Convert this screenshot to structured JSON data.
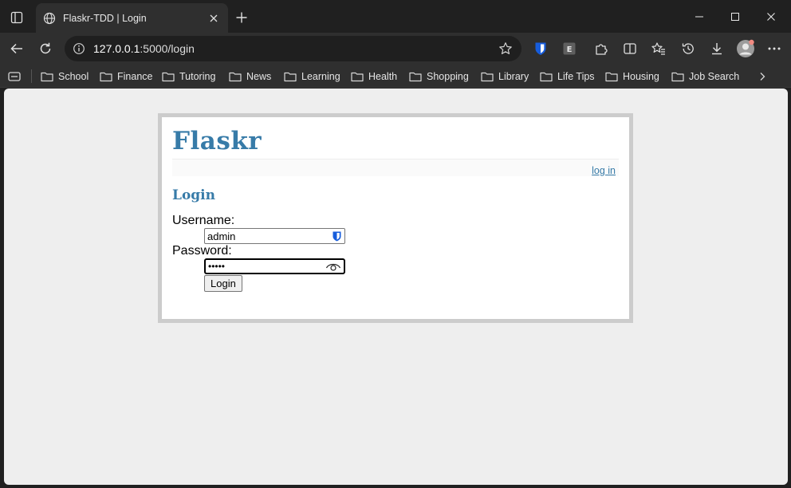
{
  "browser": {
    "tab": {
      "title": "Flaskr-TDD | Login"
    },
    "address": {
      "host": "127.0.0.1",
      "rest": ":5000/login"
    },
    "bookmarks": [
      "School",
      "Finance",
      "Tutoring",
      "News",
      "Learning",
      "Health",
      "Shopping",
      "Library",
      "Life Tips",
      "Housing",
      "Job Search"
    ],
    "icons": {
      "tab_favicon": "globe-icon",
      "extensions": [
        "bitwarden-icon",
        "e-extension-icon",
        "puzzle-icon",
        "split-screen-icon",
        "favorites-icon",
        "history-icon",
        "download-icon",
        "profile-avatar",
        "more-icon"
      ]
    },
    "colors": {
      "chrome_bg": "#202020",
      "toolbar_bg": "#2f2f2f",
      "bitwarden_blue": "#175ddc"
    }
  },
  "page": {
    "site_title": "Flaskr",
    "nav_link": "log in",
    "heading": "Login",
    "form": {
      "username_label": "Username:",
      "username_value": "admin",
      "password_label": "Password:",
      "password_value_masked": "•••••",
      "submit_label": "Login"
    },
    "colors": {
      "accent": "#377ba8",
      "page_bg": "#eeeeee",
      "border": "#cccccc"
    }
  }
}
